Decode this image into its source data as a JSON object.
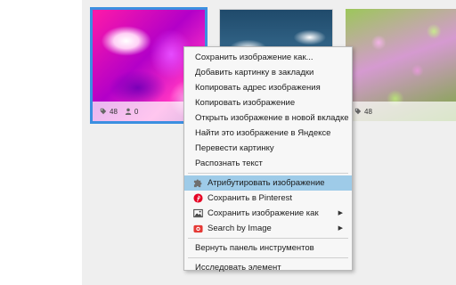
{
  "gallery": {
    "tiles": [
      {
        "image": "pink-fluid-art",
        "tags_count": "48",
        "users_count": "0"
      },
      {
        "image": "cloudy-sky"
      },
      {
        "image": "pink-flowers",
        "tags_count": "48"
      }
    ]
  },
  "context_menu": {
    "items": [
      {
        "label": "Сохранить изображение как..."
      },
      {
        "label": "Добавить картинку в закладки"
      },
      {
        "label": "Копировать адрес изображения"
      },
      {
        "label": "Копировать изображение"
      },
      {
        "label": "Открыть изображение в новой вкладке"
      },
      {
        "label": "Найти это изображение в Яндексе"
      },
      {
        "label": "Перевести картинку"
      },
      {
        "label": "Распознать текст"
      },
      {
        "label": "Атрибутировать изображение",
        "icon": "puzzle-icon",
        "highlighted": true
      },
      {
        "label": "Сохранить в Pinterest",
        "icon": "pinterest-icon"
      },
      {
        "label": "Сохранить изображение как",
        "icon": "image-icon",
        "submenu": true
      },
      {
        "label": "Search by Image",
        "icon": "camera-icon",
        "submenu": true
      },
      {
        "label": "Вернуть панель инструментов"
      },
      {
        "label": "Исследовать элемент"
      }
    ],
    "submenu_arrow": "▶"
  },
  "colors": {
    "selection_border": "#3b8fe0",
    "highlight": "#9ecbe8",
    "pinterest_red": "#e60023",
    "camera_red": "#e53935"
  }
}
